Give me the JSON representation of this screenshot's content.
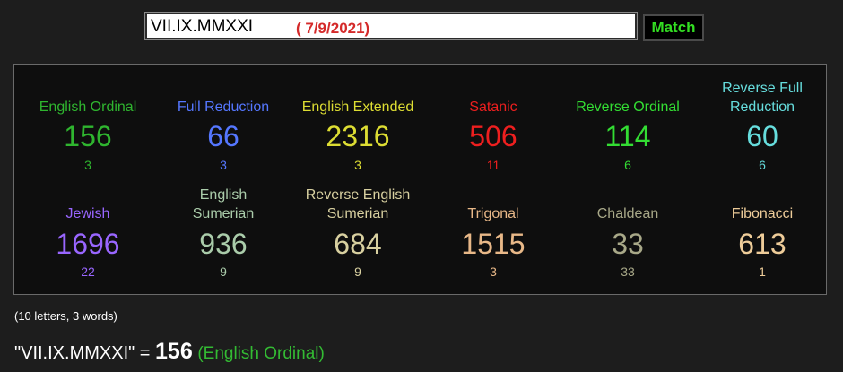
{
  "search": {
    "value": "VII.IX.MMXXI",
    "date_label": "( 7/9/2021)",
    "match_label": "Match"
  },
  "ciphers": [
    {
      "name": "English Ordinal",
      "value": "156",
      "reduced": "3",
      "color": "#2fb52f"
    },
    {
      "name": "Full Reduction",
      "value": "66",
      "reduced": "3",
      "color": "#5577ff"
    },
    {
      "name": "English Extended",
      "value": "2316",
      "reduced": "3",
      "color": "#dddd33"
    },
    {
      "name": "Satanic",
      "value": "506",
      "reduced": "11",
      "color": "#ee1f1f"
    },
    {
      "name": "Reverse Ordinal",
      "value": "114",
      "reduced": "6",
      "color": "#33dd33"
    },
    {
      "name": "Reverse Full Reduction",
      "value": "60",
      "reduced": "6",
      "color": "#66dddd"
    },
    {
      "name": "Jewish",
      "value": "1696",
      "reduced": "22",
      "color": "#9966ff"
    },
    {
      "name": "English Sumerian",
      "value": "936",
      "reduced": "9",
      "color": "#aaccaa"
    },
    {
      "name": "Reverse English Sumerian",
      "value": "684",
      "reduced": "9",
      "color": "#d8d0a0"
    },
    {
      "name": "Trigonal",
      "value": "1515",
      "reduced": "3",
      "color": "#e8b888"
    },
    {
      "name": "Chaldean",
      "value": "33",
      "reduced": "33",
      "color": "#a8a888"
    },
    {
      "name": "Fibonacci",
      "value": "613",
      "reduced": "1",
      "color": "#eecc99"
    }
  ],
  "summary": {
    "count": "(10 letters, 3 words)",
    "phrase": "\"VII.IX.MMXXI\" =",
    "value": "156",
    "cipher": "(English Ordinal)"
  }
}
